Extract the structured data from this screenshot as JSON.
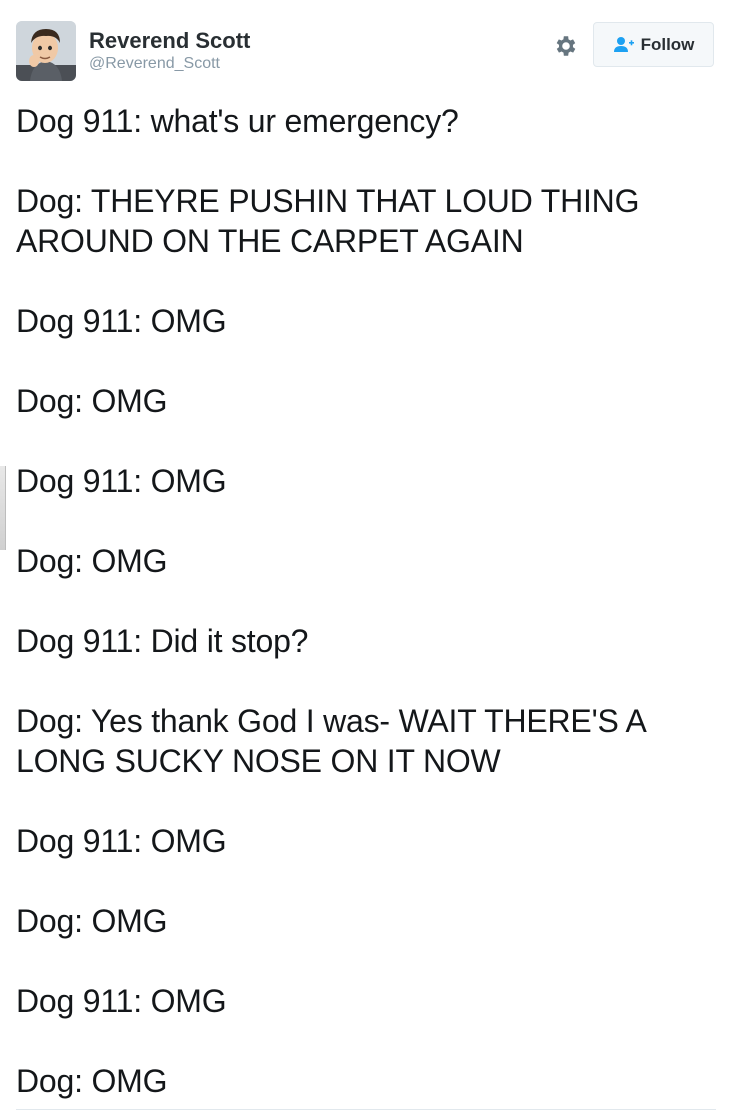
{
  "author": {
    "display_name": "Reverend Scott",
    "handle": "@Reverend_Scott"
  },
  "actions": {
    "settings_icon": "gear-icon",
    "follow_icon": "add-user-icon",
    "follow_label": "Follow"
  },
  "colors": {
    "follow_icon": "#1da1f2",
    "gear": "#66757f",
    "text": "#14171a"
  },
  "tweet": {
    "lines": [
      "Dog 911: what's ur emergency?",
      "",
      "Dog: THEYRE PUSHIN THAT LOUD THING",
      "AROUND ON THE CARPET AGAIN",
      "",
      "Dog 911: OMG",
      "",
      "Dog: OMG",
      "",
      "Dog 911: OMG",
      "",
      "Dog: OMG",
      "",
      "Dog 911: Did it stop?",
      "",
      "Dog: Yes thank God I was- WAIT THERE'S A",
      "LONG SUCKY NOSE ON IT NOW",
      "",
      "Dog 911: OMG",
      "",
      "Dog: OMG",
      "",
      "Dog 911: OMG",
      "",
      "Dog: OMG"
    ]
  }
}
